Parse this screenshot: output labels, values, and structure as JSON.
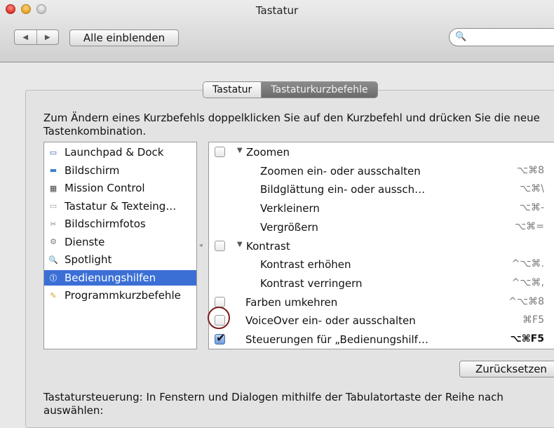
{
  "window": {
    "title": "Tastatur"
  },
  "toolbar": {
    "back_glyph": "◀",
    "forward_glyph": "▶",
    "show_all_label": "Alle einblenden",
    "search_placeholder": "",
    "search_glyph": "🔍"
  },
  "tabs": [
    {
      "label": "Tastatur",
      "active": false
    },
    {
      "label": "Tastaturkurzbefehle",
      "active": true
    }
  ],
  "instructions": "Zum Ändern eines Kurzbefehls doppelklicken Sie auf den Kurzbefehl und drücken Sie die neue Tastenkombination.",
  "categories": [
    {
      "label": "Launchpad & Dock",
      "icon": "dock-icon",
      "glyph": "▭",
      "color": "#2a5fb0",
      "selected": false
    },
    {
      "label": "Bildschirm",
      "icon": "display-icon",
      "glyph": "▬",
      "color": "#3f7fd0",
      "selected": false
    },
    {
      "label": "Mission Control",
      "icon": "mission-control-icon",
      "glyph": "▦",
      "color": "#444444",
      "selected": false
    },
    {
      "label": "Tastatur & Texteing…",
      "icon": "keyboard-icon",
      "glyph": "▭",
      "color": "#9a9a9a",
      "selected": false
    },
    {
      "label": "Bildschirmfotos",
      "icon": "screenshot-icon",
      "glyph": "✂",
      "color": "#8a8a8a",
      "selected": false
    },
    {
      "label": "Dienste",
      "icon": "gear-icon",
      "glyph": "⚙",
      "color": "#7a7a7a",
      "selected": false
    },
    {
      "label": "Spotlight",
      "icon": "spotlight-icon",
      "glyph": "🔍",
      "color": "#2d6fd8",
      "selected": false
    },
    {
      "label": "Bedienungshilfen",
      "icon": "accessibility-icon",
      "glyph": "⓵",
      "color": "#ffffff",
      "selected": true
    },
    {
      "label": "Programmkurzbefehle",
      "icon": "app-shortcuts-icon",
      "glyph": "✎",
      "color": "#d8a020",
      "selected": false
    }
  ],
  "shortcuts": [
    {
      "kind": "group",
      "label": "Zoomen",
      "key": "",
      "checked": false,
      "checkbox": true
    },
    {
      "kind": "item",
      "label": "Zoomen ein- oder ausschalten",
      "key": "⌥⌘8",
      "checkbox": false
    },
    {
      "kind": "item",
      "label": "Bildglättung ein- oder aussch…",
      "key": "⌥⌘\\",
      "checkbox": false
    },
    {
      "kind": "item",
      "label": "Verkleinern",
      "key": "⌥⌘-",
      "checkbox": false
    },
    {
      "kind": "item",
      "label": "Vergrößern",
      "key": "⌥⌘=",
      "checkbox": false
    },
    {
      "kind": "group",
      "label": "Kontrast",
      "key": "",
      "checked": false,
      "checkbox": true
    },
    {
      "kind": "item",
      "label": "Kontrast erhöhen",
      "key": "^⌥⌘.",
      "checkbox": false
    },
    {
      "kind": "item",
      "label": "Kontrast verringern",
      "key": "^⌥⌘,",
      "checkbox": false
    },
    {
      "kind": "top",
      "label": "Farben umkehren",
      "key": "^⌥⌘8",
      "checked": false,
      "checkbox": true
    },
    {
      "kind": "top",
      "label": "VoiceOver ein- oder ausschalten",
      "key": "⌘F5",
      "checked": false,
      "checkbox": true
    },
    {
      "kind": "top",
      "label": "Steuerungen für „Bedienungshilf…",
      "key": "⌥⌘F5",
      "checked": true,
      "checkbox": true,
      "bold_key": true
    }
  ],
  "disclosure_glyph": "▼",
  "check_glyph": "✔",
  "splitter_glyph": "◂",
  "reset_label": "Zurücksetzen",
  "keyboard_control_text": "Tastatursteuerung: In Fenstern und Dialogen mithilfe der Tabulatortaste der Reihe nach auswählen:"
}
